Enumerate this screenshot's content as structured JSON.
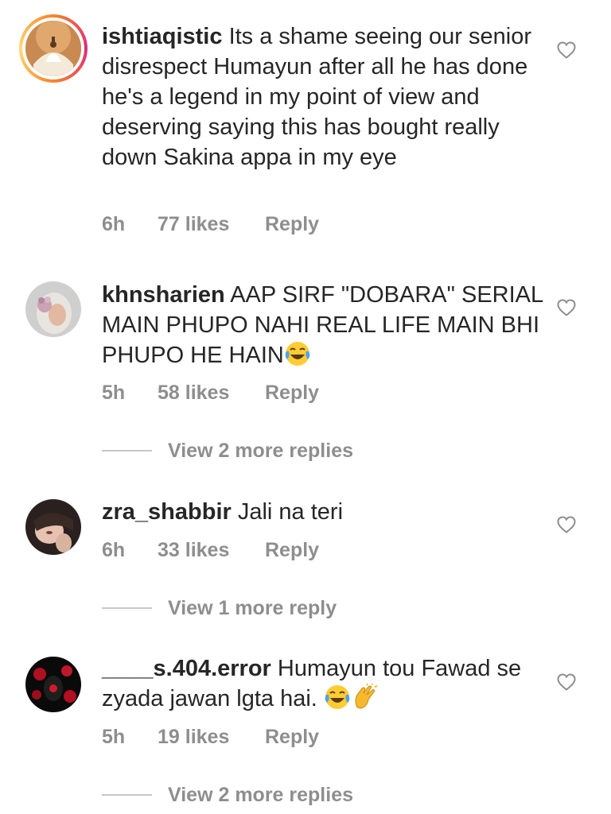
{
  "comments": [
    {
      "username": "ishtiaqistic",
      "text": "Its a shame seeing our senior disrespect Humayun after all he has done he's a legend in my point of view and deserving saying this has bought really down Sakina appa in my eye",
      "time": "6h",
      "likes": "77 likes",
      "reply": "Reply",
      "avatar_icon": "whirling-dervish-avatar",
      "has_story_ring": true
    },
    {
      "username": "khnsharien",
      "text": "AAP SIRF \"DOBARA\" SERIAL MAIN PHUPO NAHI REAL LIFE MAIN BHI PHUPO HE HAIN",
      "emoji": "😂",
      "time": "5h",
      "likes": "58 likes",
      "reply": "Reply",
      "view_replies": "View 2 more replies",
      "avatar_icon": "woman-hijab-avatar"
    },
    {
      "username": "zra_shabbir",
      "text": "Jali na teri",
      "time": "6h",
      "likes": "33 likes",
      "reply": "Reply",
      "view_replies": "View 1 more reply",
      "avatar_icon": "woman-portrait-avatar"
    },
    {
      "username": "____s.404.error",
      "text": "Humayun tou Fawad se zyada jawan lgta hai. ",
      "emoji": "😂👏",
      "time": "5h",
      "likes": "19 likes",
      "reply": "Reply",
      "view_replies": "View 2 more replies",
      "avatar_icon": "rose-dark-avatar"
    }
  ],
  "colors": {
    "text": "#262626",
    "meta": "#8e8e8e",
    "divider": "#c7c7c7"
  },
  "icons": {
    "like": "heart-outline-icon",
    "laugh_emoji": "face-with-tears-of-joy-emoji",
    "clap_emoji": "clapping-hands-emoji"
  }
}
